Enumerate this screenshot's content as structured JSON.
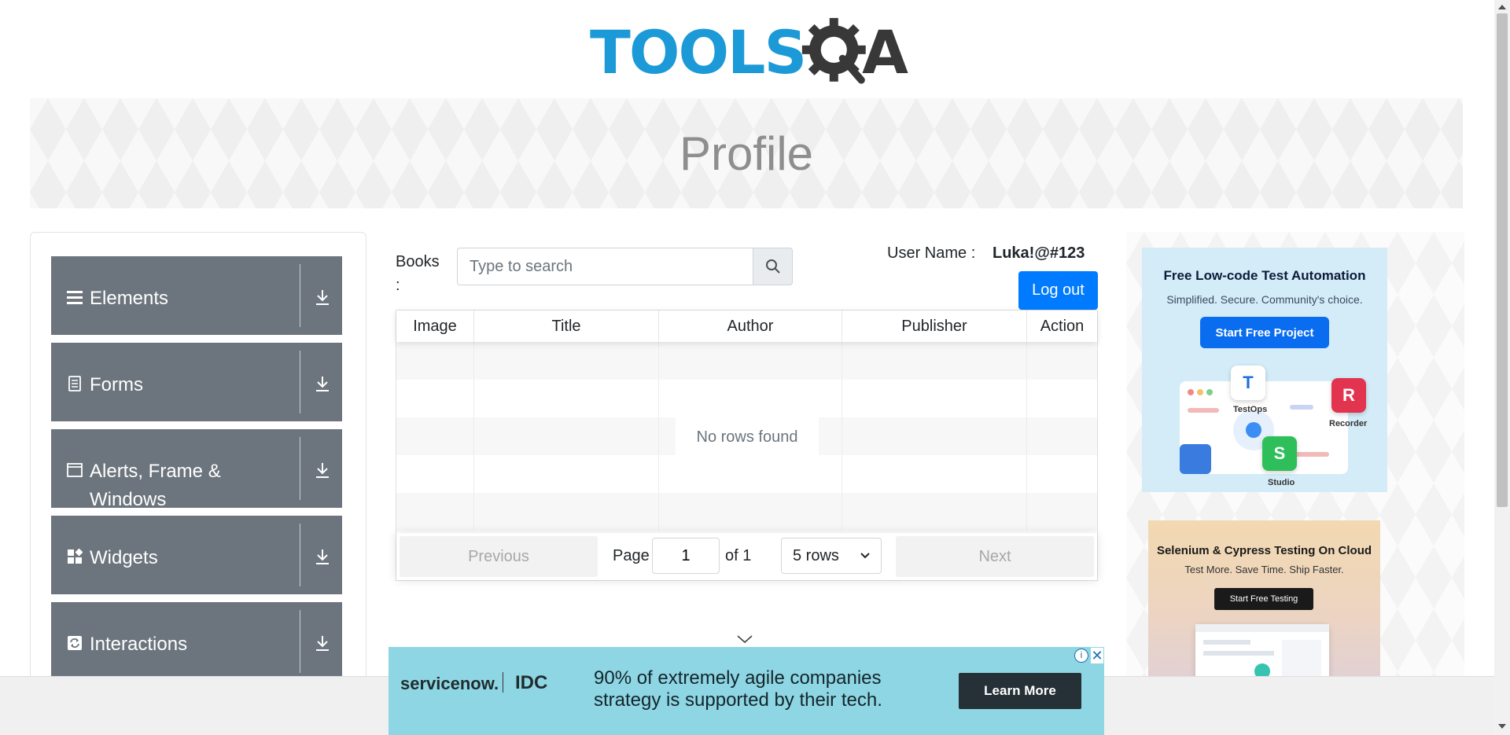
{
  "header": {
    "logo_text_left": "TOOLS",
    "logo_text_right": "A",
    "page_title": "Profile"
  },
  "sidebar": {
    "groups": [
      {
        "label": "Elements",
        "icon": "hamburger-icon"
      },
      {
        "label": "Forms",
        "icon": "document-icon"
      },
      {
        "label": "Alerts, Frame & Windows",
        "icon": "window-icon"
      },
      {
        "label": "Widgets",
        "icon": "widgets-icon"
      },
      {
        "label": "Interactions",
        "icon": "refresh-icon"
      }
    ]
  },
  "books": {
    "label": "Books :",
    "search_placeholder": "Type to search",
    "search_value": ""
  },
  "user": {
    "label": "User Name :",
    "value": "Luka!@#123",
    "logout_label": "Log out"
  },
  "table": {
    "columns": [
      "Image",
      "Title",
      "Author",
      "Publisher",
      "Action"
    ],
    "empty_message": "No rows found"
  },
  "pagination": {
    "previous_label": "Previous",
    "next_label": "Next",
    "page_label": "Page",
    "page_value": "1",
    "of_label": "of 1",
    "rows_option": "5 rows"
  },
  "ads": {
    "ad1": {
      "title": "Free Low-code Test Automation",
      "subtitle": "Simplified. Secure. Community's choice.",
      "button": "Start Free Project",
      "labels": [
        "TestOps",
        "Recorder",
        "Studio"
      ],
      "badges": [
        "T",
        "R",
        "S"
      ]
    },
    "ad2": {
      "title": "Selenium & Cypress Testing On Cloud",
      "subtitle": "Test More. Save Time. Ship Faster.",
      "button": "Start Free Testing"
    },
    "bottom": {
      "brand": "servicenow.",
      "partner": "IDC",
      "text": "90% of extremely agile companies strategy is supported by their tech.",
      "button": "Learn More"
    }
  },
  "colors": {
    "sidebar_group": "#6c757d",
    "primary": "#007bff",
    "logo_blue": "#1b9ad7",
    "logo_dark": "#383838"
  }
}
